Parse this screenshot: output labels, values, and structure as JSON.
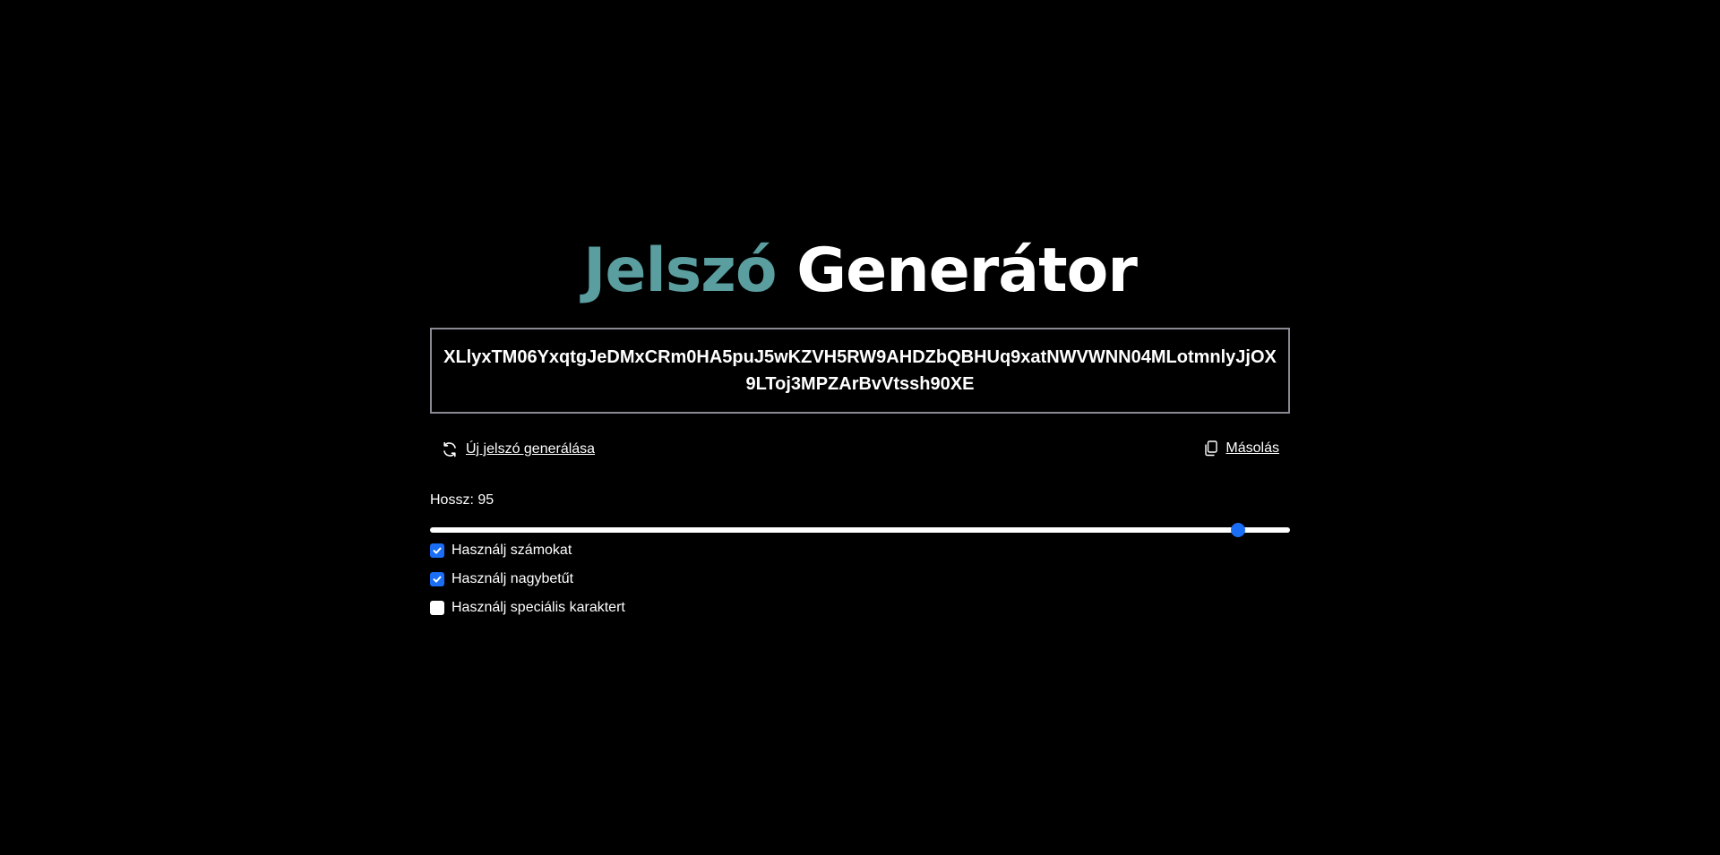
{
  "title": {
    "accent": "Jelszó",
    "main": "Generátor"
  },
  "password": {
    "value": "XLlyxTM06YxqtgJeDMxCRm0HA5puJ5wKZVH5RW9AHDZbQBHUq9xatNWVWNN04MLotmnlyJjOX9LToj3MPZArBvVtssh90XE"
  },
  "actions": {
    "generate_label": "Új jelszó generálása",
    "copy_label": "Másolás"
  },
  "length": {
    "label": "Hossz: 95",
    "value": 95,
    "slider_fraction": 0.94
  },
  "options": [
    {
      "label": "Használj számokat",
      "checked": true
    },
    {
      "label": "Használj nagybetűt",
      "checked": true
    },
    {
      "label": "Használj speciális karaktert",
      "checked": false
    }
  ],
  "colors": {
    "background": "#000000",
    "accent": "#5a9ea0",
    "control_blue": "#1a6ef5",
    "border": "#8a8a95"
  },
  "icons": {
    "generate": "refresh-icon",
    "copy": "copy-icon",
    "check": "check-icon"
  }
}
